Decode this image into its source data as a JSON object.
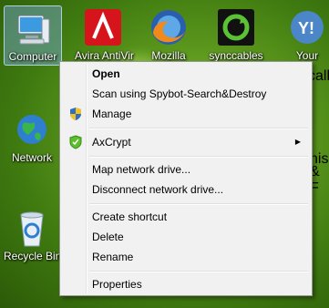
{
  "desktop": {
    "icons": [
      {
        "label": "Computer",
        "icon": "computer-icon"
      },
      {
        "label": "Avira AntiVir",
        "icon": "avira-icon"
      },
      {
        "label": "Mozilla",
        "icon": "firefox-icon"
      },
      {
        "label": "synccables",
        "icon": "sync-icon"
      },
      {
        "label": "Your",
        "icon": "yahoo-icon"
      },
      {
        "label": "Network",
        "icon": "network-icon"
      },
      {
        "label": "Recycle Bin",
        "icon": "recycle-bin-icon"
      },
      {
        "label": "calle",
        "icon": "partial-label"
      },
      {
        "label": "nis",
        "icon": "partial-label"
      },
      {
        "label": "& F",
        "icon": "partial-label"
      }
    ]
  },
  "context_menu": {
    "items": [
      {
        "label": "Open",
        "bold": true
      },
      {
        "label": "Scan using Spybot-Search&Destroy"
      },
      {
        "label": "Manage",
        "icon": "shield-icon"
      },
      {
        "label": "AxCrypt",
        "icon": "axcrypt-shield-icon",
        "submenu": true
      },
      {
        "label": "Map network drive..."
      },
      {
        "label": "Disconnect network drive..."
      },
      {
        "label": "Create shortcut"
      },
      {
        "label": "Delete"
      },
      {
        "label": "Rename"
      },
      {
        "label": "Properties"
      }
    ],
    "submenu_arrow": "▶"
  }
}
